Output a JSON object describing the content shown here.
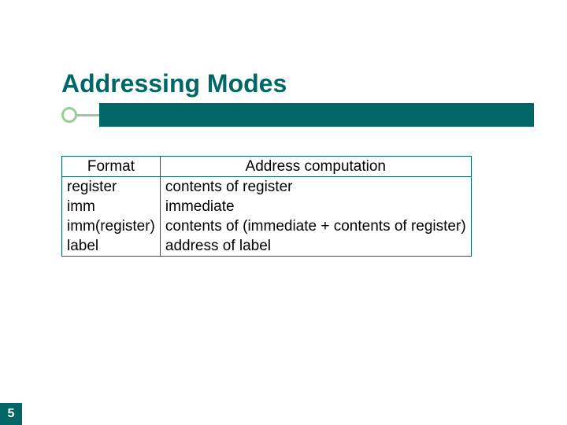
{
  "title": "Addressing Modes",
  "table": {
    "headers": {
      "format": "Format",
      "comp": "Address computation"
    },
    "rows": [
      {
        "format": "register",
        "comp": "contents of register"
      },
      {
        "format": "imm",
        "comp": "immediate"
      },
      {
        "format": "imm(register)",
        "comp": "contents of (immediate + contents of register)"
      },
      {
        "format": "label",
        "comp": "address of label"
      }
    ]
  },
  "page_number": "5"
}
